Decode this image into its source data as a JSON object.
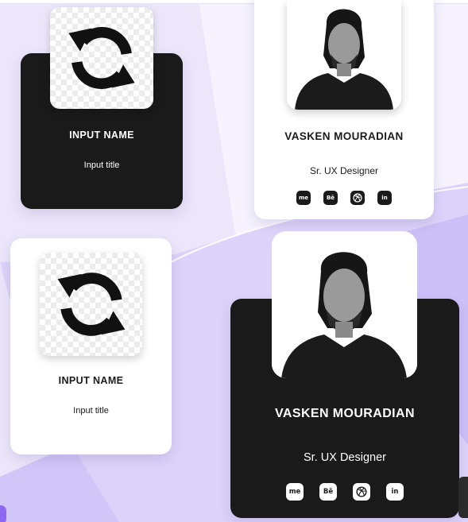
{
  "colors": {
    "background": "#ece6fb",
    "dark_card": "#1a1a1a",
    "light_card": "#ffffff",
    "accent": "#8f67f2"
  },
  "cards": [
    {
      "theme": "dark",
      "name": "INPUT NAME",
      "title": "Input title",
      "media": "refresh-icon"
    },
    {
      "theme": "light",
      "name": "VASKEN MOURADIAN",
      "title": "Sr. UX Designer",
      "media": "profile-photo",
      "socials": [
        {
          "icon": "behance-me-icon",
          "label": "me"
        },
        {
          "icon": "behance-icon",
          "label": "Bē"
        },
        {
          "icon": "dribbble-icon",
          "label": ""
        },
        {
          "icon": "linkedin-icon",
          "label": "in"
        }
      ]
    },
    {
      "theme": "light",
      "name": "INPUT NAME",
      "title": "Input title",
      "media": "refresh-icon"
    },
    {
      "theme": "dark",
      "name": "VASKEN MOURADIAN",
      "title": "Sr. UX Designer",
      "media": "profile-photo",
      "socials": [
        {
          "icon": "behance-me-icon",
          "label": "me"
        },
        {
          "icon": "behance-icon",
          "label": "Bē"
        },
        {
          "icon": "dribbble-icon",
          "label": ""
        },
        {
          "icon": "linkedin-icon",
          "label": "in"
        }
      ]
    }
  ]
}
